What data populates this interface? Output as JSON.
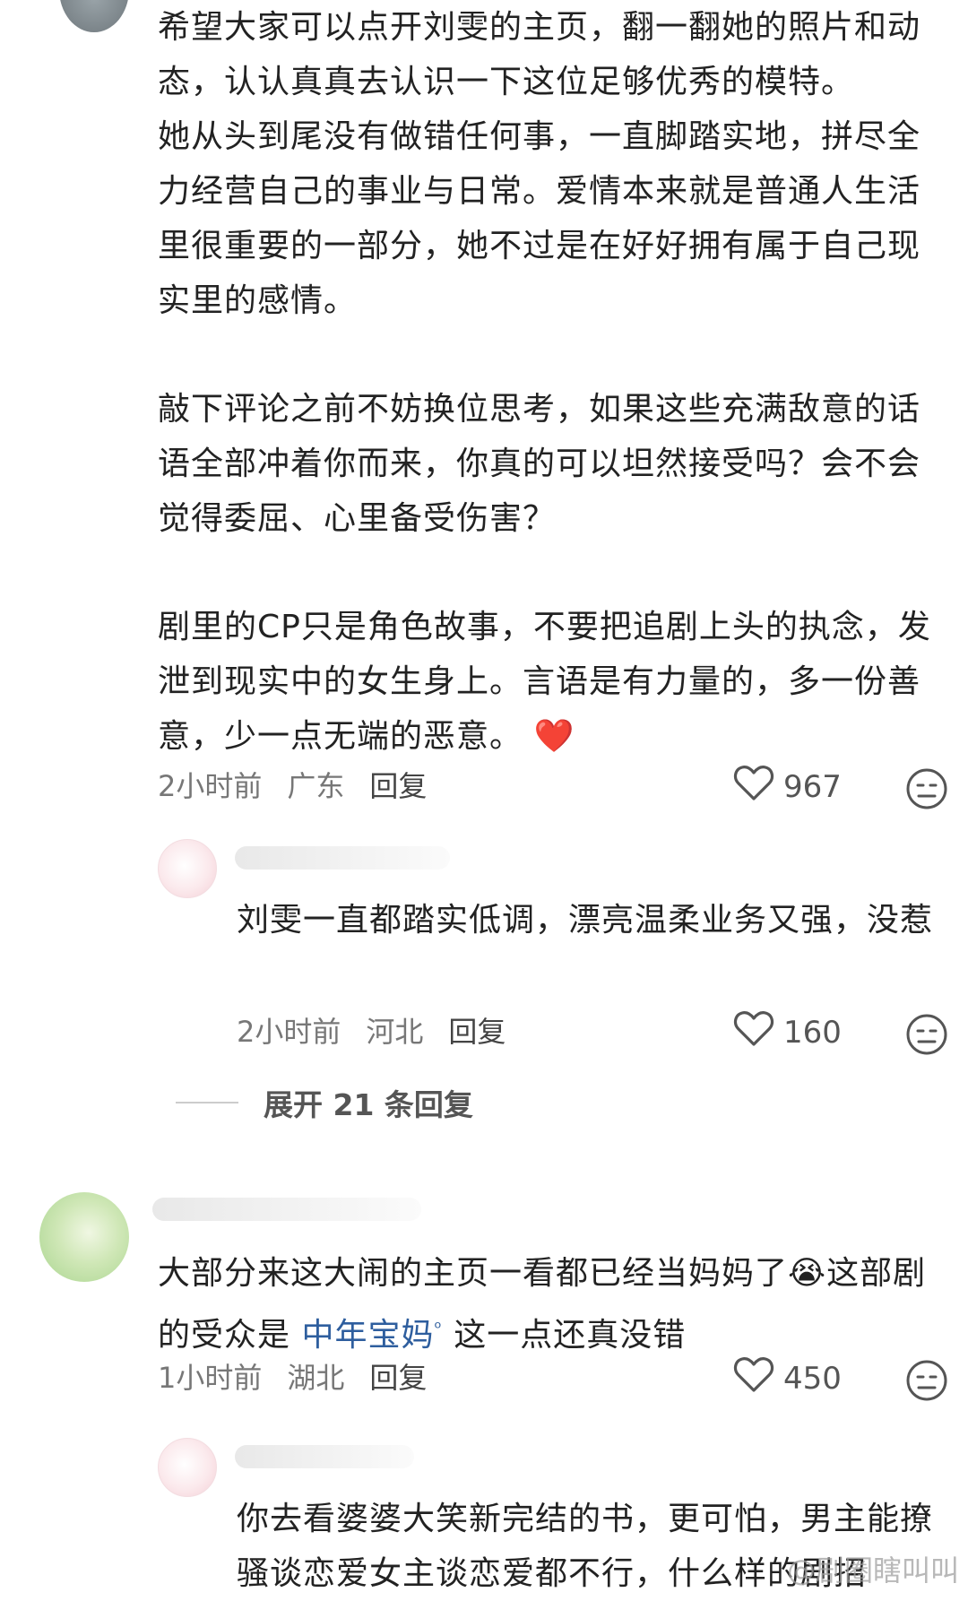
{
  "comments": [
    {
      "paragraphs": [
        "希望大家可以点开刘雯的主页，翻一翻她的照片和动态，认认真真去认识一下这位足够优秀的模特。",
        "她从头到尾没有做错任何事，一直脚踏实地，拼尽全力经营自己的事业与日常。爱情本来就是普通人生活里很重要的一部分，她不过是在好好拥有属于自己现实里的感情。",
        "敲下评论之前不妨换位思考，如果这些充满敌意的话语全部冲着你而来，你真的可以坦然接受吗？会不会觉得委屈、心里备受伤害？",
        "剧里的CP只是角色故事，不要把追剧上头的执念，发泄到现实中的女生身上。言语是有力量的，多一份善意，少一点无端的恶意。"
      ],
      "heart_emoji": "❤️",
      "time": "2小时前",
      "location": "广东",
      "reply_label": "回复",
      "likes": "967",
      "icons": {
        "like": "heart-outline-icon",
        "react": "meh-face-icon"
      }
    },
    {
      "text": "刘雯一直都踏实低调，漂亮温柔业务又强，没惹",
      "time": "2小时前",
      "location": "河北",
      "reply_label": "回复",
      "likes": "160"
    }
  ],
  "expand_replies": "展开 21 条回复",
  "comment3": {
    "text_before": "大部分来这大闹的主页一看都已经当妈妈了",
    "crying_emoji": "😭",
    "text_mid": "这部剧的受众是",
    "link": "中年宝妈",
    "text_after": "这一点还真没错",
    "time": "1小时前",
    "location": "湖北",
    "reply_label": "回复",
    "likes": "450"
  },
  "reply4": {
    "text": "你去看婆婆大笑新完结的书，更可怕，男主能撩骚谈恋爱女主谈恋爱都不行，什么样的剧招"
  },
  "watermark": "@剧圈瞎叫叫"
}
